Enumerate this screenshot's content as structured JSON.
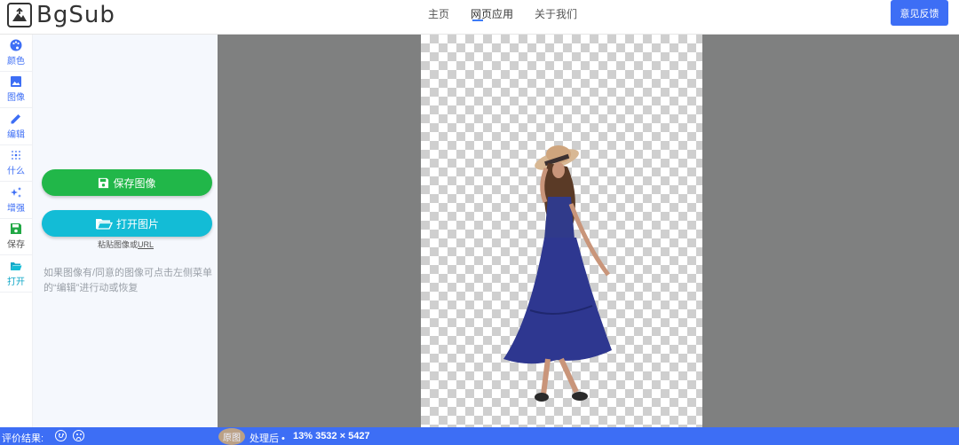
{
  "header": {
    "logo_text": "BgSub",
    "nav": [
      {
        "label": "主页"
      },
      {
        "label": "网页应用"
      },
      {
        "label": "关于我们"
      }
    ],
    "feedback_label": "意见反馈"
  },
  "rail": {
    "items": [
      {
        "label": "颜色",
        "icon": "palette-icon"
      },
      {
        "label": "图像",
        "icon": "image-icon"
      },
      {
        "label": "编辑",
        "icon": "pencil-icon"
      },
      {
        "label": "什么",
        "icon": "blur-icon"
      },
      {
        "label": "增强",
        "icon": "sparkle-icon"
      },
      {
        "label": "保存",
        "icon": "floppy-icon"
      },
      {
        "label": "打开",
        "icon": "folder-open-icon"
      }
    ]
  },
  "panel": {
    "save_label": "保存图像",
    "open_label": "打开图片",
    "paste_hint_prefix": "粘贴图像或",
    "paste_hint_link": "URL",
    "note": "如果图像有/同意的图像可点击左侧菜单的“编辑”进行动或恢复"
  },
  "status": {
    "rate_label": "评价结果:",
    "original_label": "原图",
    "processed_label": "处理后 •",
    "image_info": "13% 3532 × 5427"
  },
  "colors": {
    "accent": "#3d6ef5",
    "save_green": "#21b749",
    "open_cyan": "#13bcd6",
    "canvas_gray": "#7f8080"
  }
}
